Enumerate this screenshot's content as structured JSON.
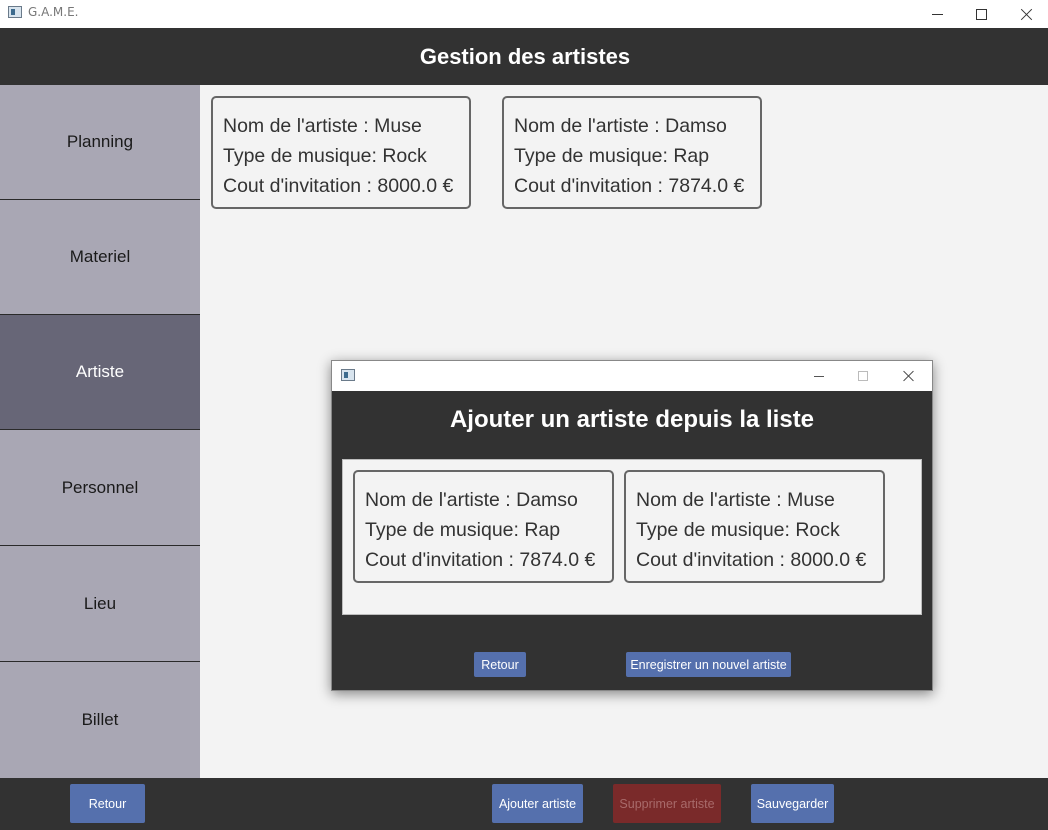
{
  "window": {
    "title": "G.A.M.E.",
    "controls": [
      "minimize-icon",
      "maximize-icon",
      "close-icon"
    ]
  },
  "header": {
    "title": "Gestion des artistes"
  },
  "sidebar": {
    "items": [
      {
        "label": "Planning",
        "active": false
      },
      {
        "label": "Materiel",
        "active": false
      },
      {
        "label": "Artiste",
        "active": true
      },
      {
        "label": "Personnel",
        "active": false
      },
      {
        "label": "Lieu",
        "active": false
      },
      {
        "label": "Billet",
        "active": false
      }
    ]
  },
  "main": {
    "artists": [
      {
        "name": "Nom de l'artiste : Muse",
        "type": "Type de musique: Rock",
        "cost": "Cout d'invitation : 8000.0 €"
      },
      {
        "name": "Nom de l'artiste : Damso",
        "type": "Type de musique: Rap",
        "cost": "Cout d'invitation : 7874.0 €"
      }
    ]
  },
  "footer": {
    "back_label": "Retour",
    "add_label": "Ajouter artiste",
    "delete_label": "Supprimer artiste",
    "save_label": "Sauvegarder"
  },
  "dialog": {
    "heading": "Ajouter un artiste depuis la liste",
    "artists": [
      {
        "name": "Nom de l'artiste : Damso",
        "type": "Type de musique: Rap",
        "cost": "Cout d'invitation : 7874.0 €"
      },
      {
        "name": "Nom de l'artiste : Muse",
        "type": "Type de musique: Rock",
        "cost": "Cout d'invitation : 8000.0 €"
      }
    ],
    "back_label": "Retour",
    "register_label": "Enregistrer un nouvel artiste"
  },
  "colors": {
    "header_bg": "#323232",
    "sidebar_bg": "#a9a7b4",
    "sidebar_active_bg": "#676677",
    "button_bg": "#5570ad",
    "danger_button_bg": "#7a2a2a"
  }
}
